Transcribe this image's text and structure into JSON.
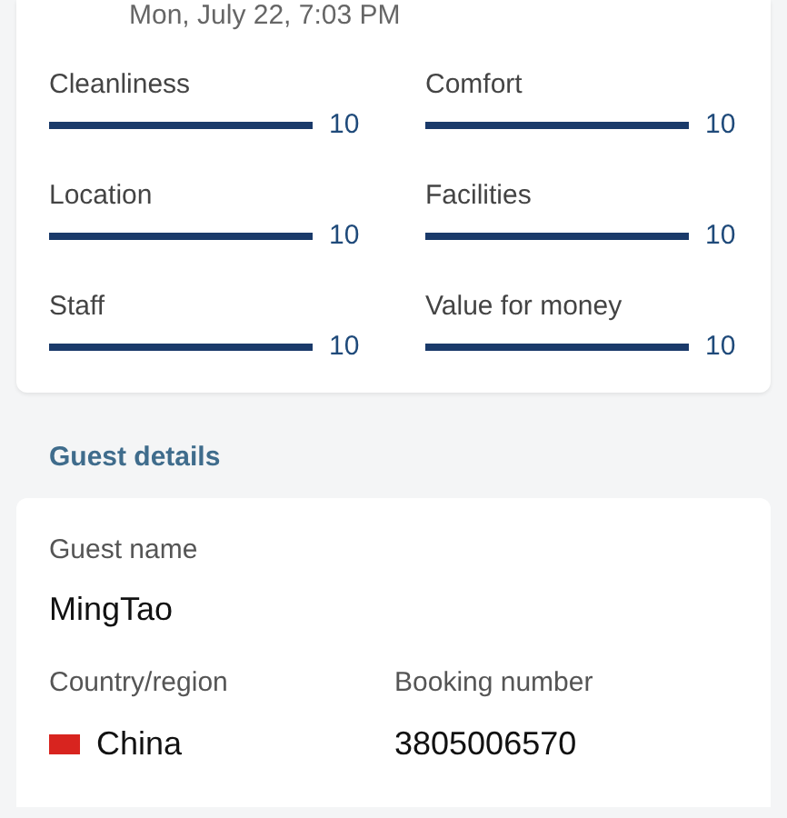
{
  "review": {
    "date": "Mon, July 22, 7:03 PM",
    "scores": [
      {
        "label": "Cleanliness",
        "level": 1.0,
        "value": "10"
      },
      {
        "label": "Comfort",
        "level": 1.0,
        "value": "10"
      },
      {
        "label": "Location",
        "level": 1.0,
        "value": "10"
      },
      {
        "label": "Facilities",
        "level": 1.0,
        "value": "10"
      },
      {
        "label": "Staff",
        "level": 1.0,
        "value": "10"
      },
      {
        "label": "Value for money",
        "level": 1.0,
        "value": "10"
      }
    ]
  },
  "guest_details": {
    "heading": "Guest details",
    "guest_name_label": "Guest name",
    "guest_name": "MingTao",
    "country_label": "Country/region",
    "country": "China",
    "booking_label": "Booking number",
    "booking_number": "3805006570"
  }
}
